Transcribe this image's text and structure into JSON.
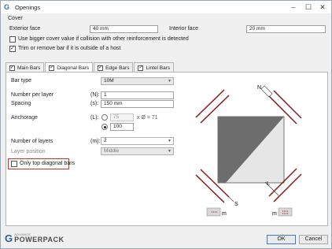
{
  "window": {
    "title": "Openings",
    "app_icon": "advance-logo-icon"
  },
  "cover": {
    "section_label": "Cover",
    "exterior_label": "Exterior face",
    "exterior_value": "40 mm",
    "interior_label": "Interior face",
    "interior_value": "20 mm",
    "bigger_cover_label": "Use bigger cover value if collision with other reinforcement is detected",
    "bigger_cover_checked": false,
    "trim_label": "Trim or remove bar if it is outside of a host",
    "trim_checked": true
  },
  "tabs": [
    {
      "label": "Main Bars",
      "checked": true,
      "active": false
    },
    {
      "label": "Diagonal Bars",
      "checked": true,
      "active": true
    },
    {
      "label": "Edge Bars",
      "checked": true,
      "active": false
    },
    {
      "label": "Lintel Bars",
      "checked": true,
      "active": false
    }
  ],
  "form": {
    "bar_type_label": "Bar type",
    "bar_type_value": "10M",
    "number_per_layer_label": "Number per layer",
    "number_per_layer_symbol": "(N):",
    "number_per_layer_value": "1",
    "spacing_label": "Spacing",
    "spacing_symbol": "(s):",
    "spacing_value": "150 mm",
    "anchorage_label": "Anchorage",
    "anchorage_symbol": "(L):",
    "anchorage_option1_value": "75",
    "anchorage_option1_suffix": "x Ø = 71",
    "anchorage_option2_value": "100",
    "anchorage_selected": 2,
    "number_of_layers_label": "Number of layers",
    "number_of_layers_symbol": "(m):",
    "number_of_layers_value": "2",
    "layer_position_label": "Layer position",
    "layer_position_value": "Middle",
    "only_top_label": "Only top diagonal bars",
    "only_top_checked": false
  },
  "diagram": {
    "label_n": "N",
    "label_s": "S",
    "label_l": "L",
    "label_m_left": "m",
    "label_m_right": "m",
    "bar_color": "#8b1a1a"
  },
  "footer": {
    "logo_sub": "ADVANCE",
    "logo_main": "POWERPACK",
    "ok_label": "OK",
    "cancel_label": "Cancel"
  }
}
